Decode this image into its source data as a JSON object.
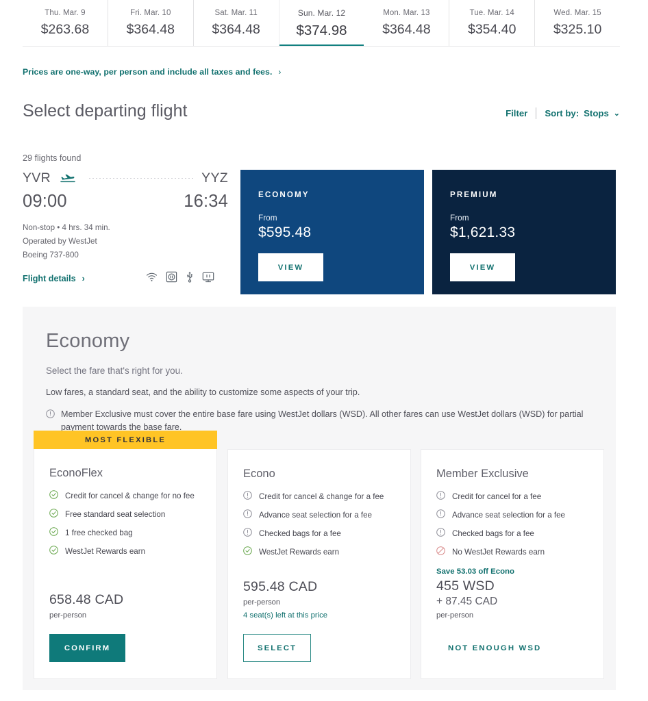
{
  "date_strip": {
    "cells": [
      {
        "label": "Thu. Mar. 9",
        "price": "$263.68",
        "selected": false
      },
      {
        "label": "Fri. Mar. 10",
        "price": "$364.48",
        "selected": false
      },
      {
        "label": "Sat. Mar. 11",
        "price": "$364.48",
        "selected": false
      },
      {
        "label": "Sun. Mar. 12",
        "price": "$374.98",
        "selected": true
      },
      {
        "label": "Mon. Mar. 13",
        "price": "$364.48",
        "selected": false
      },
      {
        "label": "Tue. Mar. 14",
        "price": "$354.40",
        "selected": false
      },
      {
        "label": "Wed. Mar. 15",
        "price": "$325.10",
        "selected": false
      }
    ]
  },
  "prices_note": {
    "text": "Prices are one-way, per person and include all taxes and fees.",
    "chevron": "›"
  },
  "section": {
    "title": "Select departing flight",
    "filter_label": "Filter",
    "sort_prefix": "Sort by:",
    "sort_value": "Stops",
    "sort_chevron": "⌄",
    "results_count": "29 flights found"
  },
  "flight": {
    "origin": "YVR",
    "destination": "YYZ",
    "depart_time": "09:00",
    "arrive_time": "16:34",
    "stops_duration": "Non-stop  •  4 hrs. 34 min.",
    "operated_by": "Operated by WestJet",
    "aircraft": "Boeing 737-800",
    "details_label": "Flight details",
    "details_chevron": "›",
    "amenities": [
      "wifi-icon",
      "power-outlet-icon",
      "usb-icon",
      "entertainment-screen-icon"
    ]
  },
  "cabins": [
    {
      "name": "ECONOMY",
      "from_label": "From",
      "price": "$595.48",
      "button_label": "VIEW",
      "color": "#0f477e"
    },
    {
      "name": "PREMIUM",
      "from_label": "From",
      "price": "$1,621.33",
      "button_label": "VIEW",
      "color": "#0a2340"
    }
  ],
  "fare_panel": {
    "title": "Economy",
    "subtitle": "Select the fare that's right for you.",
    "description": "Low fares, a standard seat, and the ability to customize some aspects of your trip.",
    "note": "Member Exclusive must cover the entire base fare using WestJet dollars (WSD). All other fares can use WestJet dollars (WSD) for partial payment towards the base fare.",
    "badge": "MOST FLEXIBLE",
    "cards": [
      {
        "title": "EconoFlex",
        "features": [
          {
            "icon": "check-circle-icon",
            "text": "Credit for cancel & change for no fee"
          },
          {
            "icon": "check-circle-icon",
            "text": "Free standard seat selection"
          },
          {
            "icon": "check-circle-icon",
            "text": "1 free checked bag"
          },
          {
            "icon": "check-circle-icon",
            "text": "WestJet Rewards earn"
          }
        ],
        "save_line": "",
        "amount": "658.48 CAD",
        "amount_sub": "",
        "per_person": "per-person",
        "seats_left": "",
        "cta_label": "CONFIRM",
        "cta_style": "solid"
      },
      {
        "title": "Econo",
        "features": [
          {
            "icon": "info-circle-icon",
            "text": "Credit for cancel & change for a fee"
          },
          {
            "icon": "info-circle-icon",
            "text": "Advance seat selection for a fee"
          },
          {
            "icon": "info-circle-icon",
            "text": "Checked bags for a fee"
          },
          {
            "icon": "check-circle-icon",
            "text": "WestJet Rewards earn"
          }
        ],
        "save_line": "",
        "amount": "595.48 CAD",
        "amount_sub": "",
        "per_person": "per-person",
        "seats_left": "4 seat(s) left at this price",
        "cta_label": "SELECT",
        "cta_style": "outline"
      },
      {
        "title": "Member Exclusive",
        "features": [
          {
            "icon": "info-circle-icon",
            "text": "Credit for cancel for a fee"
          },
          {
            "icon": "info-circle-icon",
            "text": "Advance seat selection for a fee"
          },
          {
            "icon": "info-circle-icon",
            "text": "Checked bags for a fee"
          },
          {
            "icon": "no-entry-circle-icon",
            "text": "No WestJet Rewards earn"
          }
        ],
        "save_line": "Save 53.03 off Econo",
        "amount": "455 WSD",
        "amount_sub": "+ 87.45 CAD",
        "per_person": "per-person",
        "seats_left": "",
        "cta_label": "NOT ENOUGH WSD",
        "cta_style": "text"
      }
    ]
  },
  "colors": {
    "teal": "#12716f",
    "teal_button": "#0f7a7a",
    "navy_economy": "#0f477e",
    "navy_premium": "#0a2340",
    "badge_yellow": "#ffc425",
    "panel_gray": "#f6f6f7"
  }
}
